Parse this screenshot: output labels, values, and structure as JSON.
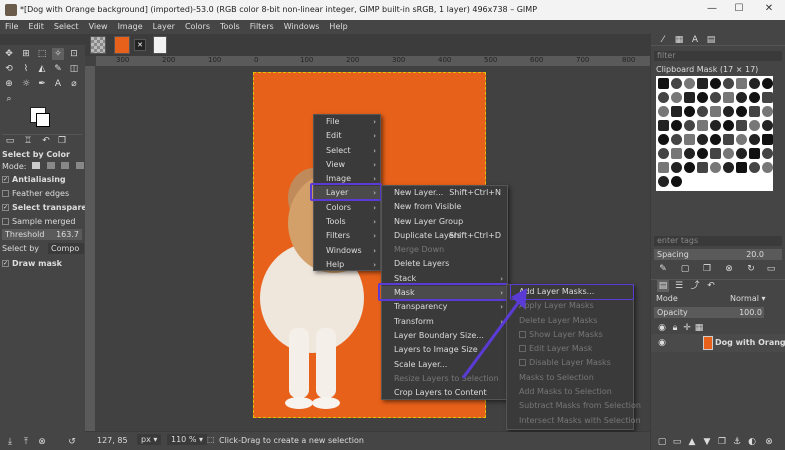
{
  "window": {
    "title": "*[Dog with Orange background] (imported)-53.0 (RGB color 8-bit non-linear integer, GIMP built-in sRGB, 1 layer) 496x738 – GIMP",
    "controls": [
      "—",
      "☐",
      "✕"
    ]
  },
  "menubar": [
    "File",
    "Edit",
    "Select",
    "View",
    "Image",
    "Layer",
    "Colors",
    "Tools",
    "Filters",
    "Windows",
    "Help"
  ],
  "ruler": {
    "ticks": [
      "300",
      "200",
      "100",
      "0",
      "100",
      "200",
      "300",
      "400",
      "500",
      "600",
      "700",
      "800"
    ]
  },
  "tool_options": {
    "title": "Select by Color",
    "mode_label": "Mode:",
    "antialiasing": "Antialiasing",
    "feather": "Feather edges",
    "select_transparent": "Select transparent",
    "sample_merged": "Sample merged",
    "threshold_label": "Threshold",
    "threshold_value": "163.7",
    "select_by_label": "Select by",
    "select_by_value": "Compo",
    "draw_mask": "Draw mask"
  },
  "status": {
    "coords": "127, 85",
    "unit": "px",
    "zoom": "110 %",
    "message": "Click-Drag to create a new selection"
  },
  "context_menu": {
    "main": [
      "File",
      "Edit",
      "Select",
      "View",
      "Image",
      "Layer",
      "Colors",
      "Tools",
      "Filters",
      "Windows",
      "Help"
    ],
    "layer_submenu": [
      {
        "label": "New Layer...",
        "shortcut": "Shift+Ctrl+N",
        "disabled": false
      },
      {
        "label": "New from Visible",
        "shortcut": "",
        "disabled": false
      },
      {
        "label": "New Layer Group",
        "shortcut": "",
        "disabled": false
      },
      {
        "label": "Duplicate Layers",
        "shortcut": "Shift+Ctrl+D",
        "disabled": false
      },
      {
        "label": "Merge Down",
        "shortcut": "",
        "disabled": true
      },
      {
        "label": "Delete Layers",
        "shortcut": "",
        "disabled": false
      },
      {
        "label": "Stack",
        "shortcut": "",
        "disabled": false
      },
      {
        "label": "Mask",
        "shortcut": "",
        "disabled": false
      },
      {
        "label": "Transparency",
        "shortcut": "",
        "disabled": false
      },
      {
        "label": "Transform",
        "shortcut": "",
        "disabled": false
      },
      {
        "label": "Layer Boundary Size...",
        "shortcut": "",
        "disabled": false
      },
      {
        "label": "Layers to Image Size",
        "shortcut": "",
        "disabled": false
      },
      {
        "label": "Scale Layer...",
        "shortcut": "",
        "disabled": false
      },
      {
        "label": "Resize Layers to Selection",
        "shortcut": "",
        "disabled": true
      },
      {
        "label": "Crop Layers to Content",
        "shortcut": "",
        "disabled": false
      }
    ],
    "mask_submenu": [
      {
        "label": "Add Layer Masks...",
        "disabled": false
      },
      {
        "label": "Apply Layer Masks",
        "disabled": true
      },
      {
        "label": "Delete Layer Masks",
        "disabled": true
      },
      {
        "label": "Show Layer Masks",
        "disabled": true
      },
      {
        "label": "Edit Layer Mask",
        "disabled": true
      },
      {
        "label": "Disable Layer Masks",
        "disabled": true
      },
      {
        "label": "Masks to Selection",
        "disabled": true
      },
      {
        "label": "Add Masks to Selection",
        "disabled": true
      },
      {
        "label": "Subtract Masks from Selection",
        "disabled": true
      },
      {
        "label": "Intersect Masks with Selection",
        "disabled": true
      }
    ]
  },
  "right_panel": {
    "filter_placeholder": "filter",
    "brushes_title": "Clipboard Mask (17 × 17)",
    "tags_placeholder": "enter tags",
    "spacing_label": "Spacing",
    "spacing_value": "20.0",
    "mode_label": "Mode",
    "mode_value": "Normal",
    "opacity_label": "Opacity",
    "opacity_value": "100.0",
    "layer_name": "Dog with Orange b"
  },
  "colors": {
    "accent": "#5b3bd6",
    "image_bg": "#e8611a"
  }
}
